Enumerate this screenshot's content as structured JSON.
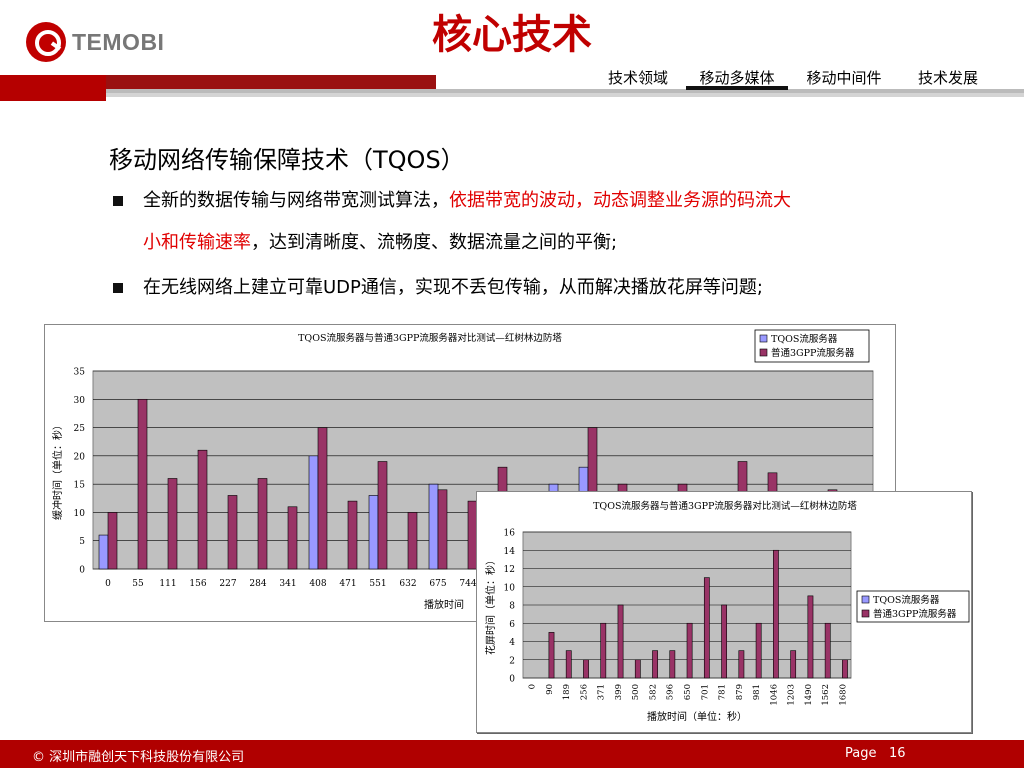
{
  "logo": {
    "text": "TEMOBI"
  },
  "title": "核心技术",
  "nav": {
    "items": [
      "技术领域",
      "移动多媒体",
      "移动中间件",
      "技术发展"
    ],
    "active": 1
  },
  "subtitle": "移动网络传输保障技术（TQOS）",
  "bullets": [
    {
      "normal_1": "全新的数据传输与网络带宽测试算法，",
      "red_1": "依据带宽的波动，动态调整业务源的码流大",
      "red_2": "小和传输速率",
      "normal_2": "，达到清晰度、流畅度、数据流量之间的平衡;"
    },
    {
      "text": "在无线网络上建立可靠UDP通信，实现不丢包传输，从而解决播放花屏等问题;"
    }
  ],
  "chart_data": [
    {
      "type": "bar",
      "title": "TQOS流服务器与普通3GPP流服务器对比测试—红树林边防塔",
      "xlabel": "播放时间",
      "ylabel": "缓冲时间（单位：秒）",
      "ylim": [
        0,
        35
      ],
      "yticks": [
        0,
        5,
        10,
        15,
        20,
        25,
        30,
        35
      ],
      "categories": [
        "0",
        "55",
        "111",
        "156",
        "227",
        "284",
        "341",
        "408",
        "471",
        "551",
        "632",
        "675",
        "744",
        "",
        "",
        "",
        "",
        "",
        "",
        "",
        "",
        "",
        "",
        "",
        "",
        ""
      ],
      "series": [
        {
          "name": "TQOS流服务器",
          "color": "#9999ff",
          "values": [
            6,
            0,
            0,
            0,
            0,
            0,
            0,
            20,
            0,
            13,
            0,
            15,
            0,
            0,
            0,
            15,
            18,
            0,
            0,
            0,
            0,
            0,
            0,
            0,
            0,
            0
          ]
        },
        {
          "name": "普通3GPP流服务器",
          "color": "#993366",
          "values": [
            10,
            30,
            16,
            21,
            13,
            16,
            11,
            25,
            12,
            19,
            10,
            14,
            12,
            18,
            0,
            0,
            25,
            15,
            0,
            15,
            0,
            19,
            17,
            0,
            14,
            0
          ]
        }
      ],
      "legend": "top-right",
      "grid": true
    },
    {
      "type": "bar",
      "title": "TQOS流服务器与普通3GPP流服务器对比测试—红树林边防塔",
      "xlabel": "播放时间（单位：秒）",
      "ylabel": "花屏时间（单位：秒）",
      "ylim": [
        0,
        16
      ],
      "yticks": [
        0,
        2,
        4,
        6,
        8,
        10,
        12,
        14,
        16
      ],
      "categories": [
        "0",
        "90",
        "189",
        "256",
        "371",
        "399",
        "500",
        "582",
        "596",
        "650",
        "701",
        "781",
        "879",
        "981",
        "1046",
        "1203",
        "1490",
        "1562",
        "1680"
      ],
      "series": [
        {
          "name": "TQOS流服务器",
          "color": "#9999ff",
          "values": [
            0,
            0,
            0,
            0,
            0,
            0,
            0,
            0,
            0,
            0,
            0,
            0,
            0,
            0,
            0,
            0,
            0,
            0,
            0
          ]
        },
        {
          "name": "普通3GPP流服务器",
          "color": "#993366",
          "values": [
            0,
            5,
            3,
            2,
            6,
            8,
            2,
            3,
            3,
            6,
            11,
            8,
            3,
            6,
            14,
            3,
            9,
            6,
            2
          ]
        }
      ],
      "legend": "right",
      "grid": true
    }
  ],
  "footer": {
    "copyright": "©  深圳市融创天下科技股份有限公司",
    "page_label": "Page",
    "page_number": "16"
  }
}
